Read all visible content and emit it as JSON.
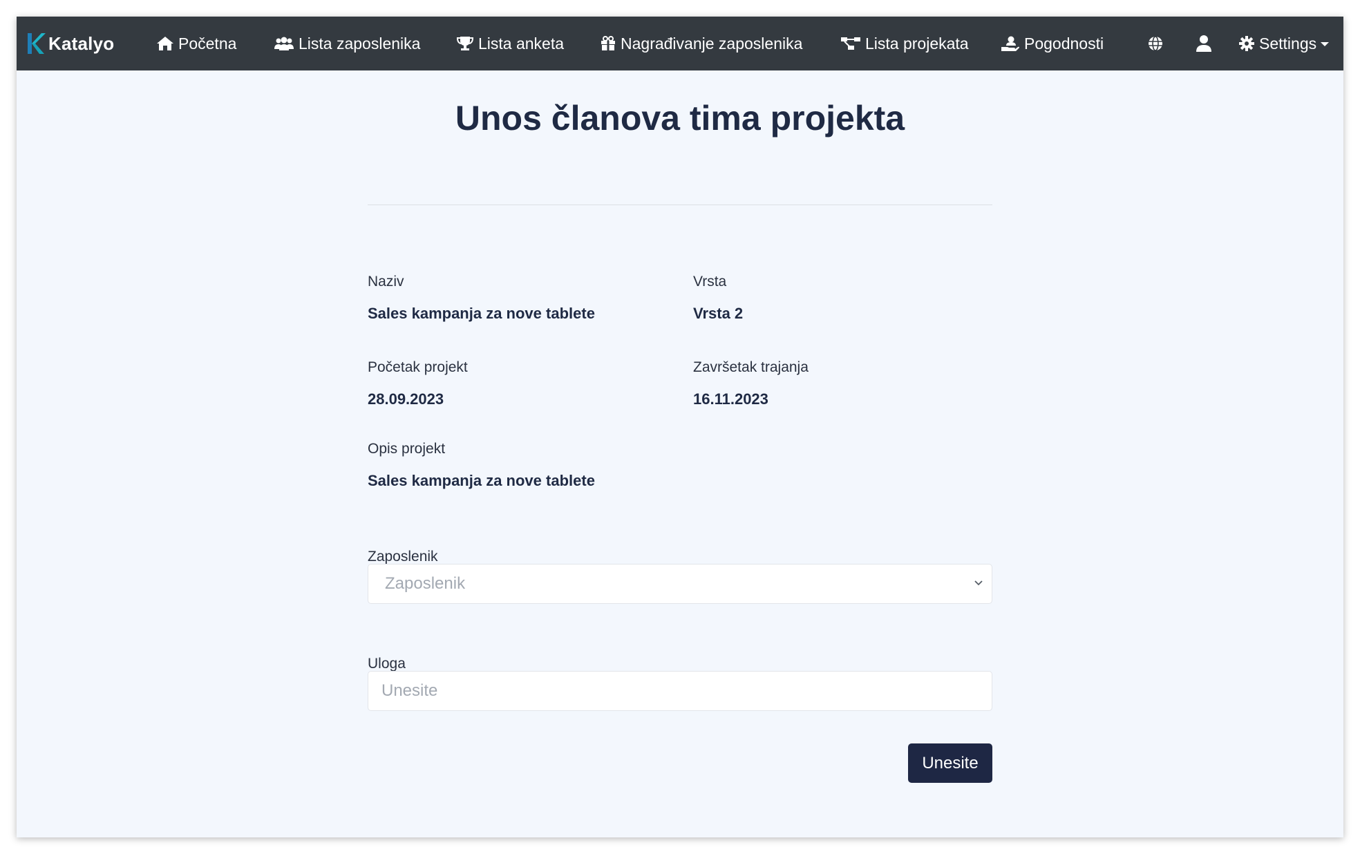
{
  "navbar": {
    "brand": "Katalyo",
    "items": [
      {
        "label": "Početna",
        "icon": "home-icon"
      },
      {
        "label": "Lista zaposlenika",
        "icon": "users-icon"
      },
      {
        "label": "Lista anketa",
        "icon": "trophy-icon"
      },
      {
        "label": "Nagrađivanje zaposlenika",
        "icon": "gift-icon"
      },
      {
        "label": "Lista projekata",
        "icon": "project-diagram-icon"
      },
      {
        "label": "Pogodnosti",
        "icon": "hand-holding-user-icon"
      }
    ],
    "globe_icon": "globe-icon",
    "user_icon": "user-icon",
    "settings_label": "Settings",
    "settings_icon": "gear-icon"
  },
  "page": {
    "title": "Unos članova tima projekta"
  },
  "details": {
    "naziv_label": "Naziv",
    "naziv_value": "Sales kampanja za nove tablete",
    "vrsta_label": "Vrsta",
    "vrsta_value": "Vrsta 2",
    "pocetak_label": "Početak projekt",
    "pocetak_value": "28.09.2023",
    "zavrsetak_label": "Završetak trajanja",
    "zavrsetak_value": "16.11.2023",
    "opis_label": "Opis projekt",
    "opis_value": "Sales kampanja za nove tablete"
  },
  "form": {
    "zaposlenik_label": "Zaposlenik",
    "zaposlenik_placeholder": "Zaposlenik",
    "uloga_label": "Uloga",
    "uloga_placeholder": "Unesite",
    "submit_label": "Unesite"
  },
  "colors": {
    "navbar_bg": "#343a40",
    "page_bg": "#f3f7fd",
    "brand_accent": "#1fb6c9",
    "button_bg": "#1e2744",
    "title_text": "#1f2a44"
  }
}
